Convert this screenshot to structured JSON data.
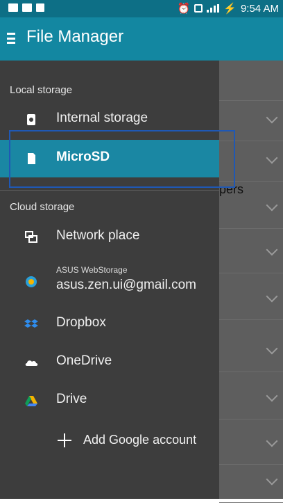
{
  "status_bar": {
    "time": "9:54 AM",
    "sim_indicator": "1"
  },
  "app_bar": {
    "title": "File Manager"
  },
  "background": {
    "partial_text": "pers"
  },
  "drawer": {
    "local_storage_header": "Local storage",
    "local_items": [
      {
        "label": "Internal storage",
        "icon": "phone-storage-icon"
      },
      {
        "label": "MicroSD",
        "icon": "sd-card-icon",
        "selected": true
      }
    ],
    "cloud_storage_header": "Cloud storage",
    "cloud_items": [
      {
        "label": "Network place",
        "icon": "network-icon"
      },
      {
        "sublabel": "ASUS WebStorage",
        "label": "asus.zen.ui@gmail.com",
        "icon": "asus-webstorage-icon"
      },
      {
        "label": "Dropbox",
        "icon": "dropbox-icon"
      },
      {
        "label": "OneDrive",
        "icon": "onedrive-icon"
      },
      {
        "label": "Drive",
        "icon": "google-drive-icon"
      }
    ],
    "add_account": "Add Google account"
  },
  "colors": {
    "primary": "#1387a1",
    "status_bar": "#0d6f86",
    "drawer_bg": "#3d3d3d",
    "selected": "#1a87a3",
    "focus_outline": "#1f58b5"
  }
}
